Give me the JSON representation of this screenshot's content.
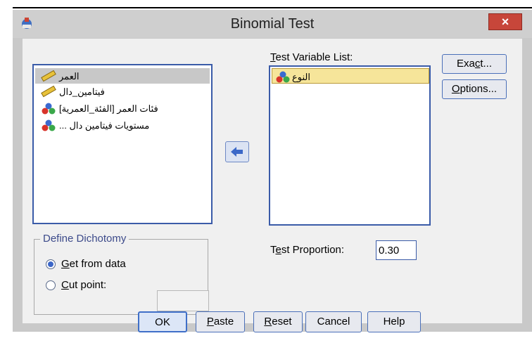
{
  "window": {
    "title": "Binomial Test",
    "close_symbol": "×"
  },
  "source_list": {
    "items": [
      {
        "label": "العمر",
        "icon": "scale-ruler-icon",
        "selected": true
      },
      {
        "label": "فيتامين_دال",
        "icon": "scale-ruler-icon",
        "selected": false
      },
      {
        "label": "فئات العمر [الفئة_العمرية]",
        "icon": "nominal-balls-icon",
        "selected": false
      },
      {
        "label": "مستويات فيتامين دال ...",
        "icon": "nominal-balls-icon",
        "selected": false
      }
    ]
  },
  "move_button": {
    "icon": "arrow-left-icon"
  },
  "test_variable_list": {
    "label_prefix": "",
    "label_mnemonic": "T",
    "label_rest": "est Variable List:",
    "items": [
      {
        "label": "النوع",
        "icon": "nominal-balls-icon",
        "selected": true
      }
    ]
  },
  "exact_button": {
    "pre": "Exa",
    "mnemonic": "c",
    "post": "t..."
  },
  "options_button": {
    "pre": "",
    "mnemonic": "O",
    "post": "ptions..."
  },
  "test_proportion": {
    "pre": "T",
    "mnemonic": "e",
    "post": "st Proportion:",
    "value": "0.30"
  },
  "define_dichotomy": {
    "legend": "Define Dichotomy",
    "get_from_data": {
      "mnemonic": "G",
      "post": "et from data",
      "selected": true
    },
    "cut_point": {
      "mnemonic": "C",
      "post": "ut point:",
      "selected": false,
      "value": ""
    }
  },
  "buttons": {
    "ok": "OK",
    "paste": {
      "mnemonic": "P",
      "post": "aste"
    },
    "reset": {
      "mnemonic": "R",
      "post": "eset"
    },
    "cancel": "Cancel",
    "help": "Help"
  },
  "colors": {
    "accent": "#3a5ba8",
    "close": "#c7463a",
    "selection_yellow": "#f6e59a"
  }
}
